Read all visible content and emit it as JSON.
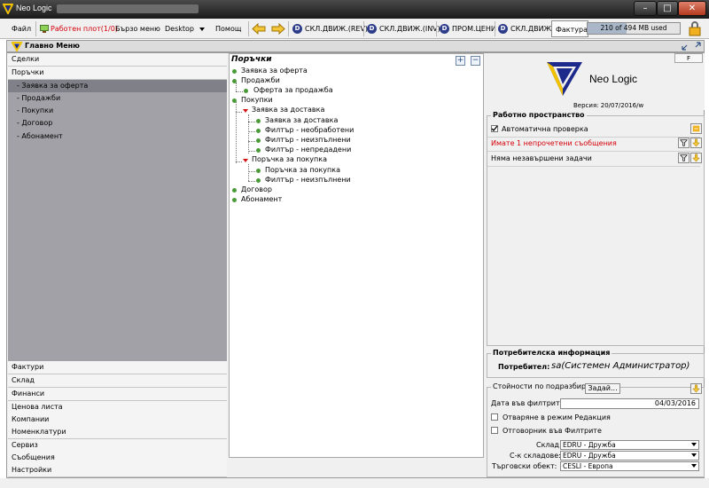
{
  "window": {
    "title": "Neo Logic",
    "minimize": "–",
    "maximize": "□",
    "close": "✕"
  },
  "menubar": {
    "file": "Файл",
    "desktop_work": "Работен плот(1/0)",
    "quick_menu": "Бързо меню",
    "desktop": "Desktop",
    "help": "Помощ",
    "tabs": [
      "СКЛ.ДВИЖ.(REV)",
      "СКЛ.ДВИЖ.(INV)",
      "ПРОМ.ЦЕНИ",
      "СКЛ.ДВИЖ.",
      "Фактура"
    ],
    "memory": "210 of 494 MB used",
    "memory_fraction": 0.425
  },
  "panel": {
    "title": "Главно Меню"
  },
  "leftnav": {
    "top_items": [
      "Сделки",
      "Поръчки"
    ],
    "sub_items": [
      "- Заявка за оферта",
      "- Продажби",
      "- Покупки",
      "- Договор",
      "- Абонамент"
    ],
    "selected_sub": 0,
    "bottom_items": [
      "Фактури",
      "Склад",
      "Финанси",
      "Ценова листа",
      "Компании",
      "Номенклатури",
      "Сервиз",
      "Съобщения",
      "Настройки"
    ]
  },
  "tree": {
    "title": "Поръчки",
    "nodes": [
      "Заявка за оферта",
      "Продажби",
      "Оферта за продажба",
      "Покупки",
      "Заявка за доставка",
      "Заявка за доставка",
      "Филтър - необработени",
      "Филтър - неизпълнени",
      "Филтър - непредадени",
      "Поръчка за покупка",
      "Поръчка за покупка",
      "Филтър - неизпълнени",
      "Договор",
      "Абонамент"
    ]
  },
  "brand": {
    "name": "Neo Logic",
    "version": "Версия: 20/07/2016/w",
    "f_button": "F"
  },
  "workspace": {
    "title": "Работно пространство",
    "auto_check": "Автоматична проверка",
    "unread": "Имате 1 непрочетени съобщения",
    "unread_color": "#d4000a",
    "tasks": "Няма незавършени задачи"
  },
  "user_info": {
    "title": "Потребителска информация",
    "label": "Потребител:",
    "value": "sa(Системен Администратор)"
  },
  "defaults": {
    "title": "Стойности по подразбиране",
    "set_button": "Задай...",
    "date_label": "Дата във филтрите:",
    "date_value": "04/03/2016",
    "edit_mode": "Отваряне в режим Редакция",
    "filter_responsible": "Отговорник във Филтрите",
    "warehouse_label": "Склад:",
    "warehouse_value": "EDRU - Дружба",
    "warehouseman_label": "С-к складове:",
    "warehouseman_value": "EDRU - Дружба",
    "retail_label": "Търговски обект:",
    "retail_value": "CESLI - Европа"
  }
}
